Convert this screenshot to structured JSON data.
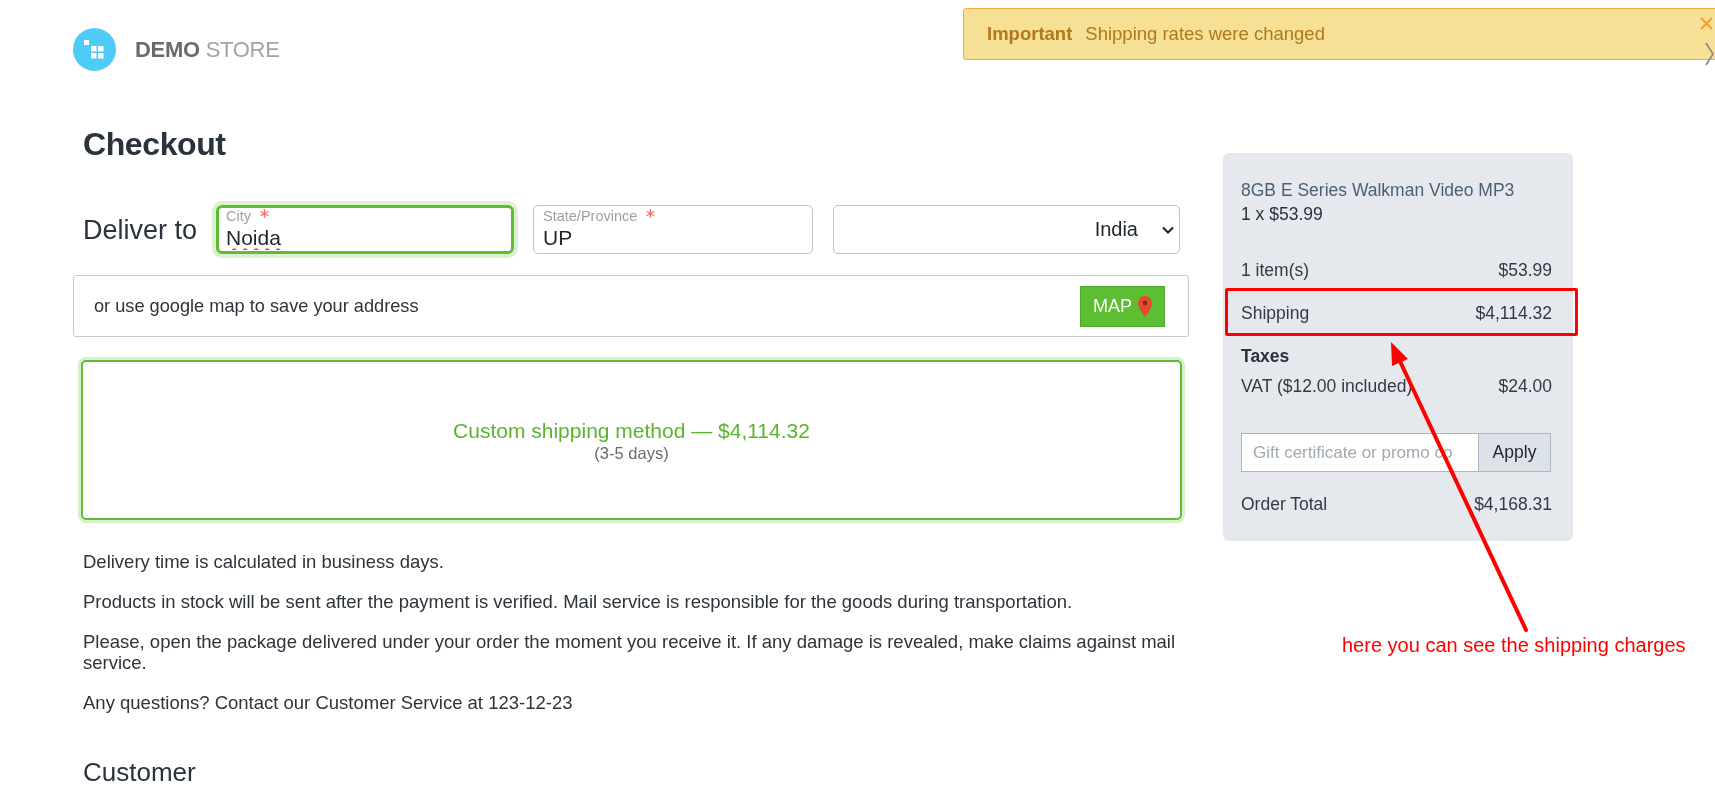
{
  "notification": {
    "title": "Important",
    "message": "Shipping rates were changed"
  },
  "logo": {
    "bold": "DEMO",
    "light": "STORE"
  },
  "page_title": "Checkout",
  "delivery": {
    "label": "Deliver to",
    "fields": [
      {
        "kind": "text",
        "label": "City",
        "required": true,
        "value": "Noida",
        "focused": true,
        "spelling_error": true
      },
      {
        "kind": "text",
        "label": "State/Province",
        "required": true,
        "value": "UP",
        "focused": false,
        "spelling_error": false
      },
      {
        "kind": "select",
        "value": "India",
        "focused": false
      }
    ]
  },
  "map_prompt": {
    "text": "or use google map to save your address",
    "button": "MAP"
  },
  "shipping_methods": [
    {
      "name": "Custom shipping method — $4,114.32",
      "duration": "(3-5 days)",
      "selected": true
    }
  ],
  "notes": [
    "Delivery time is calculated in business days.",
    "Products in stock will be sent after the payment is verified. Mail service is responsible for the goods during transportation.",
    "Please, open the package delivered under your order the moment you receive it. If any damage is revealed, make claims against mail service.",
    "Any questions? Contact our Customer Service at 123-12-23"
  ],
  "next_section": "Customer",
  "summary": {
    "products": [
      {
        "name": "8GB E Series Walkman Video MP3",
        "quantity_price": "1 x $53.99"
      }
    ],
    "lines": [
      {
        "kind": "line",
        "label": "1 item(s)",
        "value": "$53.99",
        "highlighted": false
      },
      {
        "kind": "line",
        "label": "Shipping",
        "value": "$4,114.32",
        "highlighted": true
      },
      {
        "kind": "heading",
        "label": "Taxes"
      },
      {
        "kind": "line",
        "label": "VAT ($12.00 included)",
        "value": "$24.00",
        "highlighted": false
      }
    ],
    "promo": {
      "placeholder": "Gift certificate or promo co",
      "button": "Apply"
    },
    "total": {
      "label": "Order Total",
      "value": "$4,168.31"
    }
  },
  "annotation": {
    "text": "here you can see the shipping charges"
  }
}
